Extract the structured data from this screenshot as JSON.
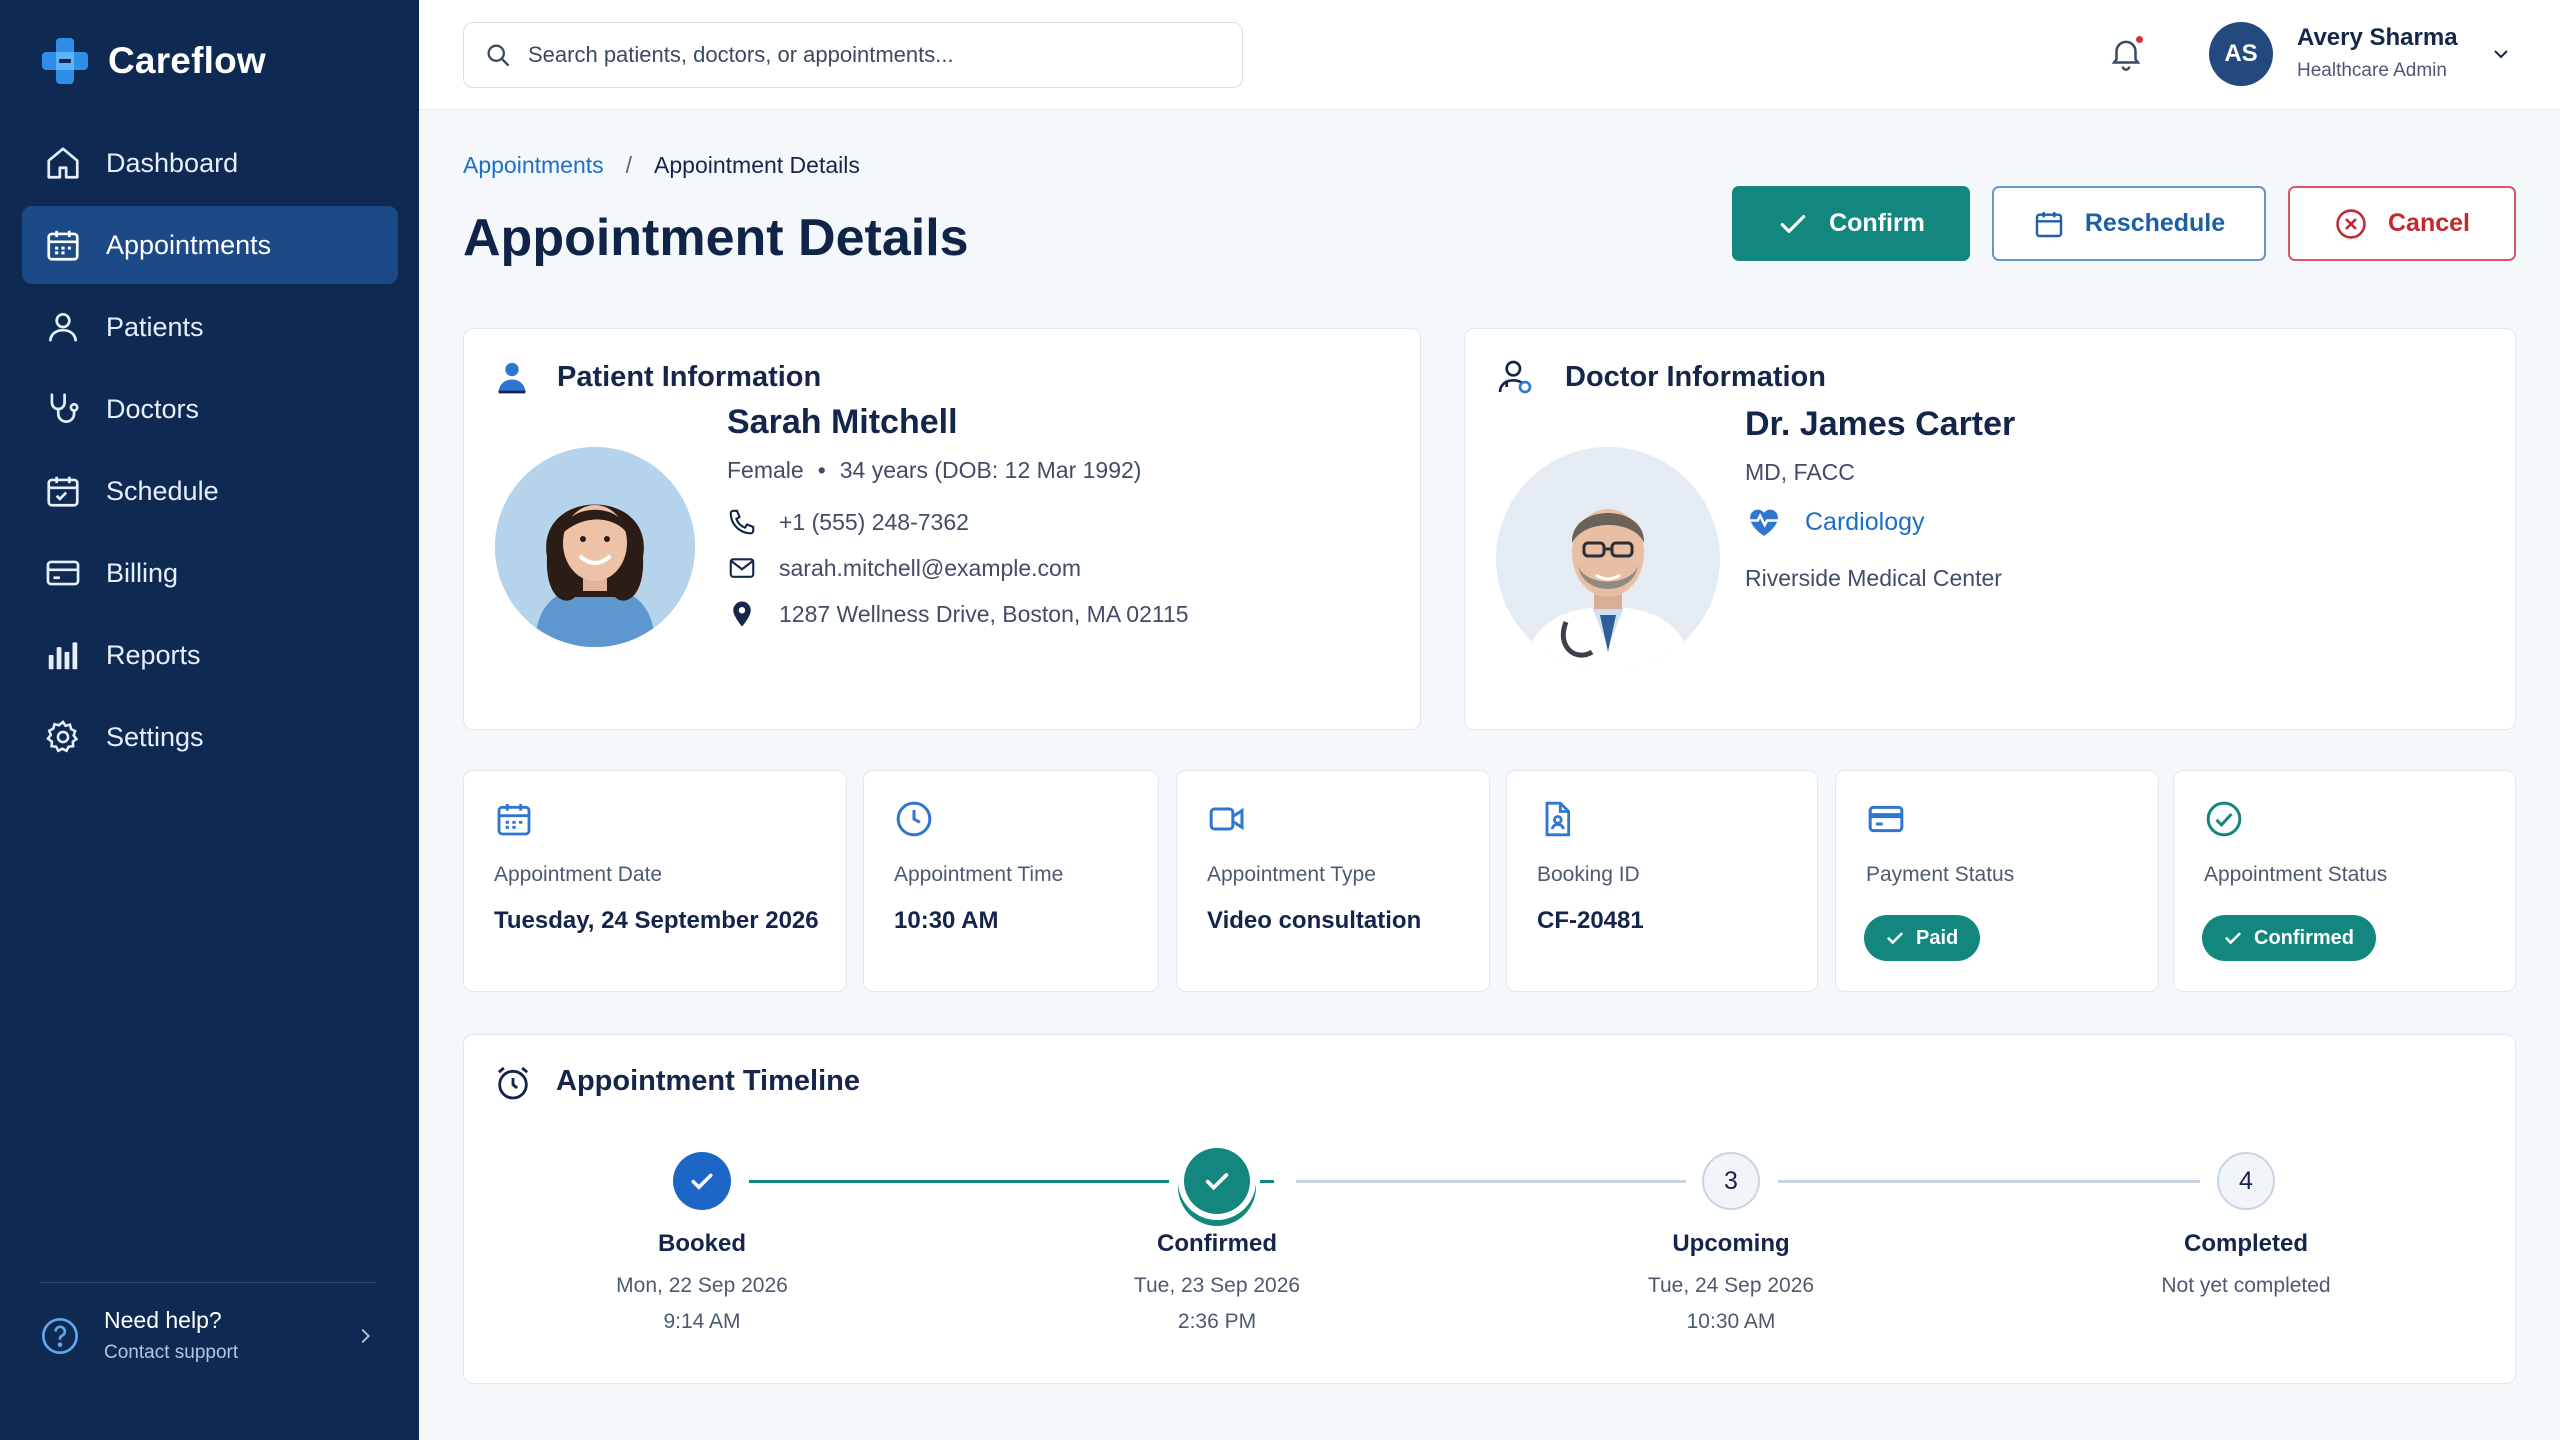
{
  "app": {
    "name": "Careflow"
  },
  "colors": {
    "sidebar": "#0f2a52",
    "accent_teal": "#13877e",
    "link_blue": "#1c6ec7",
    "danger": "#c2282f"
  },
  "sidebar": {
    "items": [
      {
        "label": "Dashboard",
        "icon": "home-icon"
      },
      {
        "label": "Appointments",
        "icon": "calendar-icon",
        "active": true
      },
      {
        "label": "Patients",
        "icon": "user-icon"
      },
      {
        "label": "Doctors",
        "icon": "stethoscope-icon"
      },
      {
        "label": "Schedule",
        "icon": "calendar-grid-icon"
      },
      {
        "label": "Billing",
        "icon": "credit-card-icon"
      },
      {
        "label": "Reports",
        "icon": "bar-chart-icon"
      },
      {
        "label": "Settings",
        "icon": "gear-icon"
      }
    ],
    "help": {
      "title": "Need help?",
      "subtitle": "Contact support"
    }
  },
  "topbar": {
    "search_placeholder": "Search patients, doctors, or appointments...",
    "user": {
      "initials": "AS",
      "name": "Avery Sharma",
      "role": "Healthcare Admin"
    }
  },
  "breadcrumb": {
    "parent": "Appointments",
    "separator": "/",
    "current": "Appointment Details"
  },
  "page": {
    "title": "Appointment Details"
  },
  "actions": {
    "confirm": "Confirm",
    "reschedule": "Reschedule",
    "cancel": "Cancel"
  },
  "patient": {
    "section_title": "Patient Information",
    "name": "Sarah Mitchell",
    "gender": "Female",
    "dot": "•",
    "age": "34 years (DOB: 12 Mar 1992)",
    "phone": "+1 (555) 248-7362",
    "email": "sarah.mitchell@example.com",
    "address": "1287 Wellness Drive, Boston, MA 02115"
  },
  "doctor": {
    "section_title": "Doctor Information",
    "name": "Dr. James Carter",
    "credentials": "MD, FACC",
    "specialty": "Cardiology",
    "facility": "Riverside Medical Center"
  },
  "stats": [
    {
      "label": "Appointment Date",
      "value": "Tuesday, 24 September 2026"
    },
    {
      "label": "Appointment Time",
      "value": "10:30 AM"
    },
    {
      "label": "Appointment Type",
      "value": "Video consultation"
    },
    {
      "label": "Booking ID",
      "value": "CF-20481"
    },
    {
      "label": "Payment Status",
      "value": "Paid"
    },
    {
      "label": "Appointment Status",
      "value": "Confirmed"
    }
  ],
  "timeline": {
    "section_title": "Appointment Timeline",
    "steps": [
      {
        "title": "Booked",
        "date": "Mon, 22 Sep 2026",
        "time": "9:14 AM",
        "state": "done"
      },
      {
        "title": "Confirmed",
        "date": "Tue, 23 Sep 2026",
        "time": "2:36 PM",
        "state": "current"
      },
      {
        "number": "3",
        "title": "Upcoming",
        "date": "Tue, 24 Sep 2026",
        "time": "10:30 AM",
        "state": "pending"
      },
      {
        "number": "4",
        "title": "Completed",
        "date": "Not yet completed",
        "state": "pending"
      }
    ]
  }
}
